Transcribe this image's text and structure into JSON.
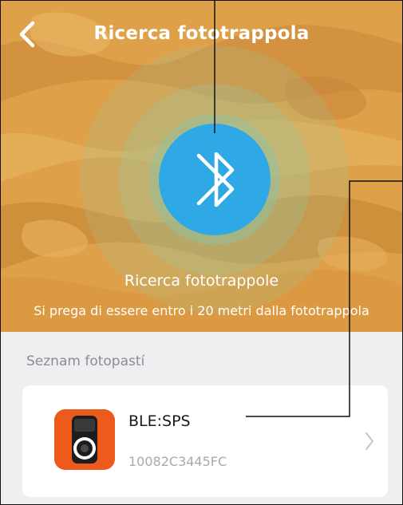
{
  "header": {
    "title": "Ricerca fototrappola",
    "back_icon": "chevron-left-icon"
  },
  "scan": {
    "icon": "bluetooth-icon",
    "status": "Ricerca fototrappole",
    "hint": "Si prega di essere entro i 20 metri dalla fototrappola"
  },
  "list": {
    "section_title": "Seznam fotopastí",
    "devices": [
      {
        "name": "BLE:SPS",
        "id": "10082C3445FC",
        "icon": "camera-trap-icon",
        "chevron": "chevron-right-icon"
      }
    ]
  },
  "colors": {
    "hero_bg": "#dfa24a",
    "bluetooth": "#2fa9e6",
    "app_icon": "#ec5a1c",
    "page_bg": "#efeff1"
  }
}
